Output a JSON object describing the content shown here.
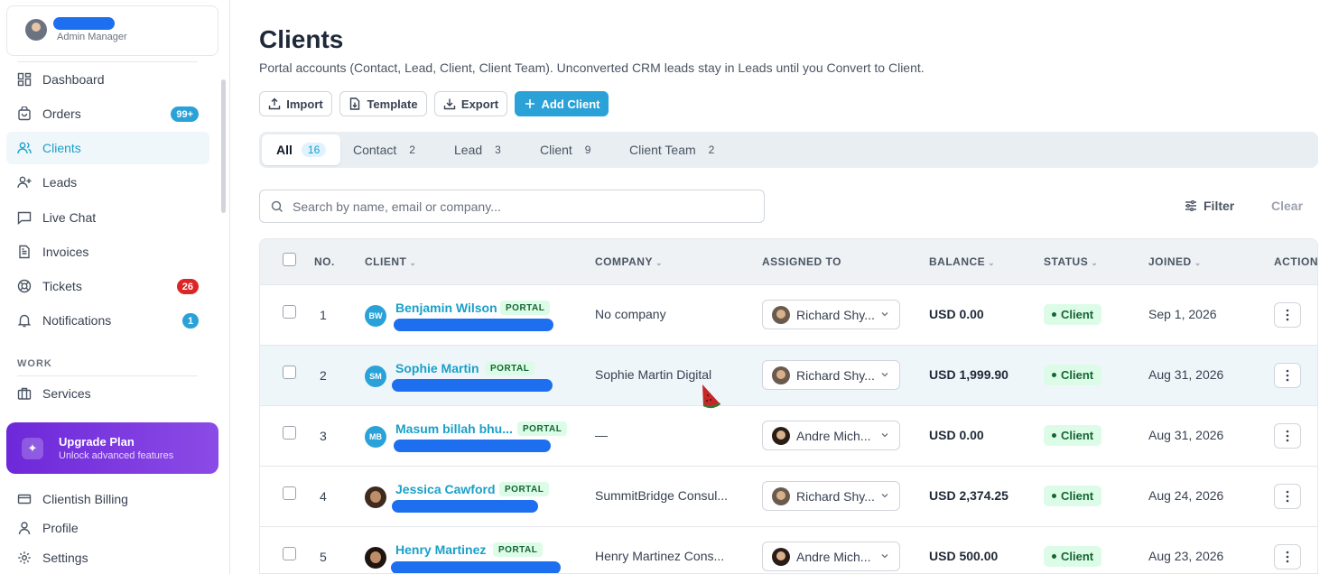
{
  "sidebar": {
    "user_role": "Admin Manager",
    "nav": [
      {
        "label": "Dashboard",
        "icon": "dashboard-icon"
      },
      {
        "label": "Orders",
        "icon": "orders-icon",
        "badge": "99+"
      },
      {
        "label": "Clients",
        "icon": "clients-icon",
        "active": true
      },
      {
        "label": "Leads",
        "icon": "leads-icon"
      },
      {
        "label": "Live Chat",
        "icon": "chat-icon"
      },
      {
        "label": "Invoices",
        "icon": "invoice-icon"
      },
      {
        "label": "Tickets",
        "icon": "tickets-icon",
        "badge": "26"
      },
      {
        "label": "Notifications",
        "icon": "bell-icon",
        "badge": "1"
      }
    ],
    "section_work": "WORK",
    "services": "Services",
    "upgrade": {
      "title": "Upgrade Plan",
      "subtitle": "Unlock advanced features"
    },
    "bottom": [
      {
        "label": "Clientish Billing",
        "icon": "billing-icon"
      },
      {
        "label": "Profile",
        "icon": "profile-icon"
      },
      {
        "label": "Settings",
        "icon": "settings-icon"
      }
    ]
  },
  "page": {
    "title": "Clients",
    "subtitle": "Portal accounts (Contact, Lead, Client, Client Team). Unconverted CRM leads stay in Leads until you Convert to Client."
  },
  "toolbar": {
    "import": "Import",
    "template": "Template",
    "export": "Export",
    "add_client": "Add Client"
  },
  "tabs": [
    {
      "label": "All",
      "count": "16",
      "active": true
    },
    {
      "label": "Contact",
      "count": "2"
    },
    {
      "label": "Lead",
      "count": "3"
    },
    {
      "label": "Client",
      "count": "9"
    },
    {
      "label": "Client Team",
      "count": "2"
    }
  ],
  "search": {
    "placeholder": "Search by name, email or company..."
  },
  "filter_label": "Filter",
  "clear_label": "Clear",
  "table": {
    "headers": {
      "no": "NO.",
      "client": "CLIENT",
      "company": "COMPANY",
      "assigned": "ASSIGNED TO",
      "balance": "BALANCE",
      "status": "STATUS",
      "joined": "JOINED",
      "action": "ACTION"
    },
    "portal_label": "PORTAL",
    "rows": [
      {
        "no": "1",
        "initials": "BW",
        "name": "Benjamin Wilson",
        "company": "No company",
        "assigned": "Richard Shy...",
        "balance": "USD 0.00",
        "status": "Client",
        "joined": "Sep 1, 2026"
      },
      {
        "no": "2",
        "initials": "SM",
        "name": "Sophie Martin",
        "company": "Sophie Martin Digital",
        "assigned": "Richard Shy...",
        "balance": "USD 1,999.90",
        "status": "Client",
        "joined": "Aug 31, 2026"
      },
      {
        "no": "3",
        "initials": "MB",
        "name": "Masum billah bhu...",
        "company": "—",
        "assigned": "Andre Mich...",
        "balance": "USD 0.00",
        "status": "Client",
        "joined": "Aug 31, 2026"
      },
      {
        "no": "4",
        "initials": "",
        "name": "Jessica Cawford",
        "company": "SummitBridge Consul...",
        "assigned": "Richard Shy...",
        "balance": "USD 2,374.25",
        "status": "Client",
        "joined": "Aug 24, 2026"
      },
      {
        "no": "5",
        "initials": "",
        "name": "Henry Martinez",
        "company": "Henry Martinez Cons...",
        "assigned": "Andre Mich...",
        "balance": "USD 500.00",
        "status": "Client",
        "joined": "Aug 23, 2026"
      }
    ]
  }
}
